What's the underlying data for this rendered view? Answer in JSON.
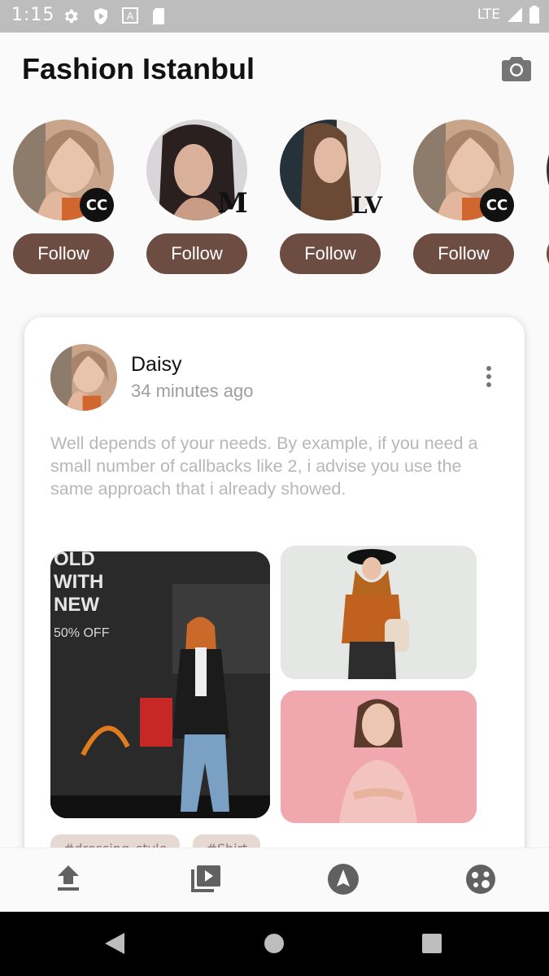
{
  "status_bar": {
    "time": "1:15",
    "network": "LTE",
    "icons": [
      "gear-icon",
      "shield-icon",
      "a-icon",
      "sd-card-icon",
      "signal-icon",
      "battery-icon"
    ]
  },
  "app_bar": {
    "title": "Fashion Istanbul",
    "action_icon": "camera-icon"
  },
  "stories": [
    {
      "brand": "CC",
      "brand_label": "",
      "follow_label": "Follow"
    },
    {
      "brand": "M",
      "brand_label": "",
      "follow_label": "Follow"
    },
    {
      "brand": "LV",
      "brand_label": "",
      "follow_label": "Follow"
    },
    {
      "brand": "CC",
      "brand_label": "",
      "follow_label": "Follow"
    }
  ],
  "post": {
    "author": "Daisy",
    "time": "34 minutes ago",
    "text": "Well depends of your needs. By example, if you need a small number of callbacks like 2, i advise you use the same approach that i already showed.",
    "image_text": {
      "line1": "OLD",
      "line2": "WITH",
      "line3": "NEW",
      "line4": "50% OFF"
    },
    "tags": [
      "#dressing_style",
      "#Shirt"
    ]
  },
  "bottom_nav": [
    "upload-icon",
    "video-library-icon",
    "navigation-icon",
    "face-icon"
  ],
  "colors": {
    "accent": "#6d4c41",
    "status_bar": "#bdbdbd",
    "text_secondary": "#9e9e9e"
  }
}
